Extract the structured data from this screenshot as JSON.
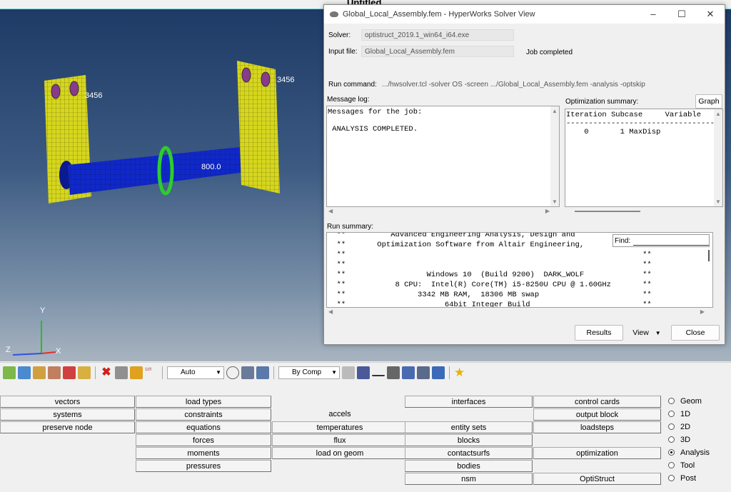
{
  "app": {
    "doc_title": "Untitled"
  },
  "viewport": {
    "node_label_left": "3456",
    "node_label_right": "3456",
    "value_label": "800.0",
    "axes": {
      "x": "X",
      "y": "Y",
      "z": "Z"
    }
  },
  "dialog": {
    "title": "Global_Local_Assembly.fem - HyperWorks Solver View",
    "solver_label": "Solver:",
    "solver_value": "optistruct_2019.1_win64_i64.exe",
    "input_label": "Input file:",
    "input_value": "Global_Local_Assembly.fem",
    "status": "Job completed",
    "run_command_label": "Run command:",
    "run_command_value": ".../hwsolver.tcl -solver OS -screen .../Global_Local_Assembly.fem -analysis -optskip",
    "message_log_label": "Message log:",
    "message_log_lines": [
      "Messages for the job:",
      "",
      "",
      " ANALYSIS COMPLETED."
    ],
    "opt_summary_label": "Optimization summary:",
    "graph_button": "Graph",
    "opt_summary_lines": [
      "Iteration Subcase     Variable",
      "------------------------------------",
      "    0       1 MaxDisp"
    ],
    "run_summary_label": "Run summary:",
    "run_summary_lines": [
      "  **          Advanced Engineering Analysis, Design and",
      "  **       Optimization Software from Altair Engineering,",
      "  **                                                                  **",
      "  **                                                                  **",
      "  **                  Windows 10  (Build 9200)  DARK_WOLF             **",
      "  **           8 CPU:  Intel(R) Core(TM) i5-8250U CPU @ 1.60GHz       **",
      "  **                3342 MB RAM,  18306 MB swap                       **",
      "  **                      64bit Integer Build                         **"
    ],
    "find_label": "Find:",
    "results_button": "Results",
    "view_button": "View",
    "close_button": "Close"
  },
  "toolbar": {
    "vis_mode": "Auto",
    "color_mode": "By Comp"
  },
  "menu": {
    "col1": [
      "vectors",
      "systems",
      "preserve node"
    ],
    "col2": [
      "load types",
      "constraints",
      "equations",
      "forces",
      "moments",
      "pressures"
    ],
    "col3": [
      "accels",
      "temperatures",
      "flux",
      "load on geom"
    ],
    "col4": [
      "interfaces",
      "entity sets",
      "blocks",
      "contactsurfs",
      "bodies",
      "nsm"
    ],
    "col5": [
      "control cards",
      "output block",
      "loadsteps",
      "optimization",
      "OptiStruct"
    ],
    "radios": [
      "Geom",
      "1D",
      "2D",
      "3D",
      "Analysis",
      "Tool",
      "Post"
    ],
    "radio_selected": "Analysis"
  }
}
